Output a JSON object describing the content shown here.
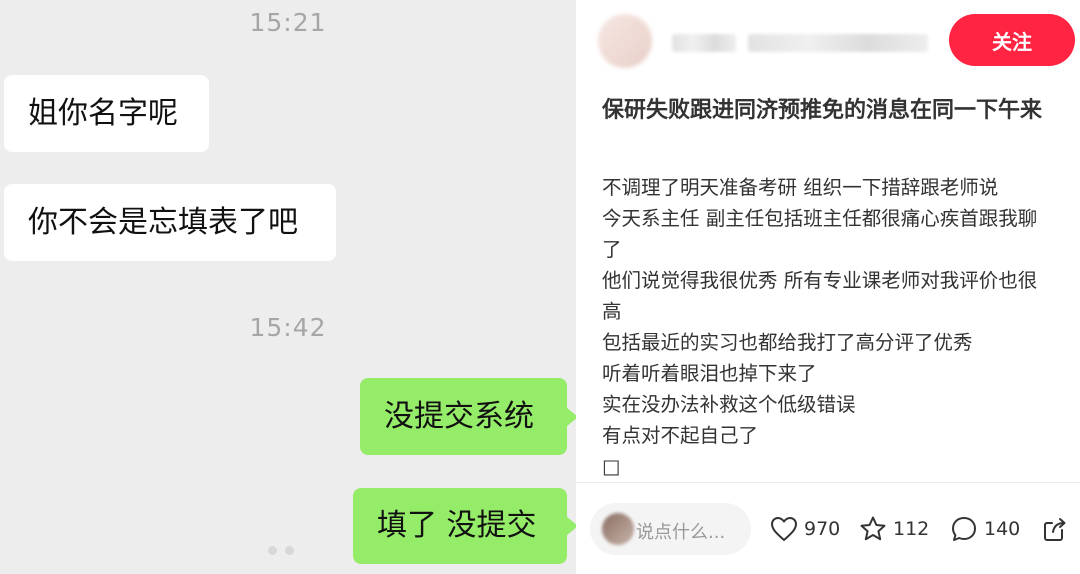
{
  "chat": {
    "messages": [
      {
        "type": "time",
        "text": "15:21"
      },
      {
        "type": "incoming",
        "text": "姐你名字呢"
      },
      {
        "type": "incoming",
        "text": "你不会是忘填表了吧"
      },
      {
        "type": "time",
        "text": "15:42"
      },
      {
        "type": "outgoing",
        "text": "没提交系统"
      },
      {
        "type": "outgoing",
        "text": "填了 没提交"
      }
    ]
  },
  "post": {
    "follow_label": "关注",
    "title": "保研失败跟进同济预推免的消息在同一下午来",
    "content_lines": [
      "不调理了明天准备考研 组织一下措辞跟老师说",
      "今天系主任 副主任包括班主任都很痛心疾首跟我聊",
      "了",
      "他们说觉得我很优秀 所有专业课老师对我评价也很",
      "高",
      "包括最近的实习也都给我打了高分评了优秀",
      "听着听着眼泪也掉下来了",
      "实在没办法补救这个低级错误",
      "有点对不起自己了",
      "□"
    ],
    "comment_placeholder": "说点什么...",
    "likes": "970",
    "favorites": "112",
    "comments": "140"
  },
  "colors": {
    "chat_bg": "#ededed",
    "outgoing_bubble": "#95ec69",
    "incoming_bubble": "#ffffff",
    "follow_button": "#ff2442"
  },
  "icons": [
    "heart-icon",
    "star-icon",
    "comment-icon",
    "share-icon"
  ]
}
